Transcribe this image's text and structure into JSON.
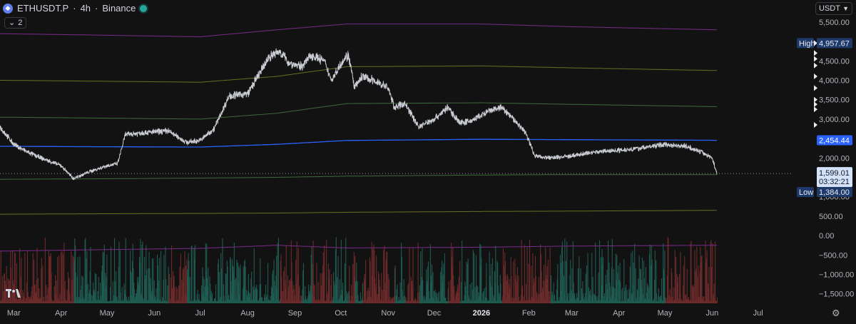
{
  "header": {
    "symbol": "ETHUSDT.P",
    "interval": "4h",
    "exchange": "Binance",
    "separator": "·",
    "indicator_count": "2",
    "currency": "USDT"
  },
  "colors": {
    "background": "#121212",
    "candles": "#c9ccd3",
    "center_band": "#2962ff",
    "band_1": "#3d6a3a",
    "band_2": "#6b6d22",
    "band_3": "#7a2a8a",
    "volume_up": "#1f5b50",
    "volume_down": "#6b2a2a",
    "current_price_label": "#d4e3fb",
    "high_low_label": "#1e3a6b"
  },
  "chart_data": {
    "type": "line",
    "title": "",
    "xlabel": "",
    "ylabel": "",
    "ylim": [
      -1800,
      5700
    ],
    "y_ticks": [
      "5,500.00",
      "5,000.00",
      "4,500.00",
      "4,000.00",
      "3,500.00",
      "3,000.00",
      "2,500.00",
      "2,000.00",
      "1,500.00",
      "1,000.00",
      "500.00",
      "0.00",
      "−500.00",
      "−1,000.00",
      "−1,500.00"
    ],
    "y_tick_values": [
      5500,
      5000,
      4500,
      4000,
      3500,
      3000,
      2500,
      2000,
      1500,
      1000,
      500,
      0,
      -500,
      -1000,
      -1500
    ],
    "x_ticks": [
      "Mar",
      "Apr",
      "May",
      "Jun",
      "Jul",
      "Aug",
      "Sep",
      "Oct",
      "Nov",
      "Dec",
      "2026",
      "Feb",
      "Mar",
      "Apr",
      "May",
      "Jun",
      "Jul"
    ],
    "x_tick_values": [
      "2025-03-01",
      "2025-04-01",
      "2025-05-01",
      "2025-06-01",
      "2025-07-01",
      "2025-08-01",
      "2025-09-01",
      "2025-10-01",
      "2025-11-01",
      "2025-12-01",
      "2026-01-01",
      "2026-02-01",
      "2026-03-01",
      "2026-04-01",
      "2026-05-01",
      "2026-06-01",
      "2026-07-01"
    ],
    "bold_x_tick": "2026",
    "x_range": [
      "2025-02-20",
      "2026-07-24"
    ],
    "price_series": {
      "name": "ETHUSDT.P",
      "x": [
        "2025-02-20",
        "2025-03-01",
        "2025-03-10",
        "2025-03-20",
        "2025-04-01",
        "2025-04-09",
        "2025-04-20",
        "2025-05-01",
        "2025-05-08",
        "2025-05-13",
        "2025-05-25",
        "2025-06-10",
        "2025-06-22",
        "2025-07-01",
        "2025-07-10",
        "2025-07-20",
        "2025-08-01",
        "2025-08-10",
        "2025-08-15",
        "2025-08-22",
        "2025-08-28",
        "2025-09-05",
        "2025-09-12",
        "2025-09-20",
        "2025-09-25",
        "2025-10-02",
        "2025-10-06",
        "2025-10-10",
        "2025-10-15",
        "2025-10-25",
        "2025-11-01",
        "2025-11-05",
        "2025-11-12",
        "2025-11-21",
        "2025-12-01",
        "2025-12-10",
        "2025-12-18",
        "2025-12-25",
        "2026-01-06",
        "2026-01-14",
        "2026-01-22",
        "2026-01-30",
        "2026-02-05",
        "2026-02-15",
        "2026-03-01",
        "2026-03-15",
        "2026-04-01",
        "2026-04-15",
        "2026-05-01",
        "2026-05-15",
        "2026-05-25",
        "2026-06-01",
        "2026-06-04"
      ],
      "values": [
        2800,
        2350,
        2150,
        1980,
        1800,
        1470,
        1650,
        1800,
        1850,
        2600,
        2650,
        2700,
        2400,
        2450,
        2750,
        3600,
        3650,
        4250,
        4600,
        4750,
        4450,
        4350,
        4650,
        4500,
        4000,
        4500,
        4650,
        3800,
        4100,
        3950,
        3800,
        3300,
        3400,
        2800,
        3000,
        3300,
        2900,
        2950,
        3200,
        3300,
        3000,
        2650,
        2050,
        2000,
        2050,
        2150,
        2200,
        2250,
        2350,
        2300,
        2150,
        2000,
        1599
      ]
    },
    "bands": [
      {
        "x": [
          "2025-02-20",
          "2025-04-15",
          "2025-07-01",
          "2025-08-20",
          "2025-10-05",
          "2026-01-01",
          "2026-03-01",
          "2026-06-04"
        ],
        "values": [
          5200,
          5170,
          5120,
          5300,
          5450,
          5450,
          5380,
          5300
        ]
      },
      {
        "x": [
          "2025-02-20",
          "2025-04-15",
          "2025-07-01",
          "2025-08-20",
          "2025-10-05",
          "2026-01-01",
          "2026-03-01",
          "2026-06-04"
        ],
        "values": [
          4000,
          3980,
          3950,
          4100,
          4350,
          4370,
          4320,
          4250
        ]
      },
      {
        "x": [
          "2025-02-20",
          "2025-04-15",
          "2025-07-01",
          "2025-08-20",
          "2025-10-05",
          "2026-01-01",
          "2026-03-01",
          "2026-06-04"
        ],
        "values": [
          3050,
          3030,
          3000,
          3150,
          3400,
          3420,
          3380,
          3320
        ]
      },
      {
        "x": [
          "2025-02-20",
          "2025-04-15",
          "2025-07-01",
          "2025-08-20",
          "2025-10-05",
          "2026-01-01",
          "2026-03-01",
          "2026-06-04"
        ],
        "values": [
          2300,
          2290,
          2280,
          2350,
          2450,
          2480,
          2470,
          2454
        ]
      },
      {
        "x": [
          "2025-02-20",
          "2025-04-15",
          "2025-07-01",
          "2025-08-20",
          "2025-10-05",
          "2026-01-01",
          "2026-03-01",
          "2026-06-04"
        ],
        "values": [
          1450,
          1460,
          1480,
          1500,
          1530,
          1560,
          1570,
          1570
        ]
      },
      {
        "x": [
          "2025-02-20",
          "2025-04-15",
          "2025-07-01",
          "2025-08-20",
          "2025-10-05",
          "2026-01-01",
          "2026-03-01",
          "2026-06-04"
        ],
        "values": [
          550,
          560,
          570,
          580,
          600,
          620,
          630,
          650
        ]
      },
      {
        "x": [
          "2025-02-20",
          "2025-04-15",
          "2025-07-01",
          "2025-08-20",
          "2025-10-05",
          "2026-01-01",
          "2026-03-01",
          "2026-06-04"
        ],
        "values": [
          -400,
          -370,
          -330,
          -250,
          -320,
          -300,
          -270,
          -250
        ]
      }
    ],
    "grid": false,
    "legend": "none",
    "price_labels": {
      "high_label": "High",
      "high_value": "4,957.67",
      "center_value": "2,454.44",
      "current_value": "1,599.01",
      "countdown": "03:32:21",
      "low_label": "Low",
      "low_value": "1,384.00"
    },
    "level_values": {
      "high": 4957.67,
      "center": 2454.44,
      "current": 1599.01,
      "low": 1384.0
    }
  }
}
